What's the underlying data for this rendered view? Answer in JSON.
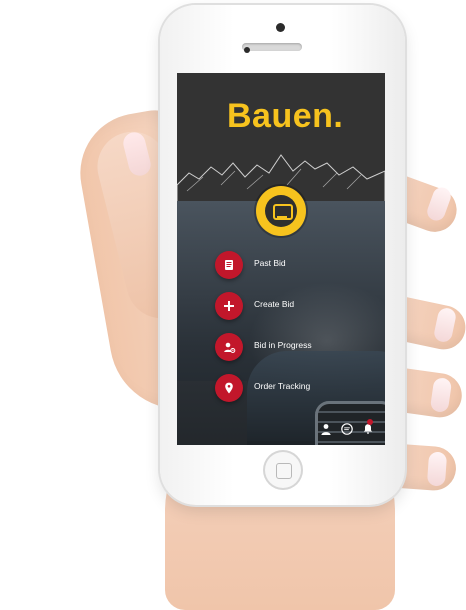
{
  "app": {
    "brand": "Bauen."
  },
  "menu": {
    "items": [
      {
        "label": "Past Bid",
        "icon": "document-icon"
      },
      {
        "label": "Create Bid",
        "icon": "plus-icon"
      },
      {
        "label": "Bid in Progress",
        "icon": "user-clock-icon"
      },
      {
        "label": "Order Tracking",
        "icon": "location-pin-icon"
      }
    ]
  },
  "bottom_bar": {
    "icons": [
      "user-icon",
      "chat-icon",
      "bell-icon"
    ]
  },
  "colors": {
    "accent": "#f7c31e",
    "menu_icon_bg": "#c2172b",
    "top_bg": "#333333"
  }
}
